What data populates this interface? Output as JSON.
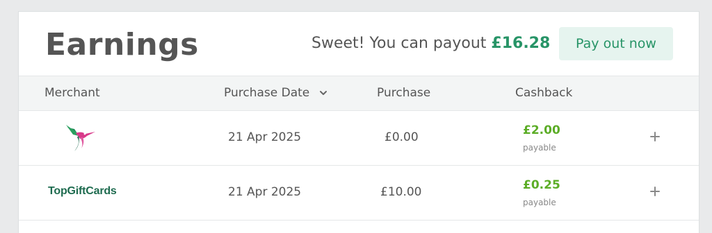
{
  "header": {
    "title": "Earnings",
    "payout_prefix": "Sweet! You can payout ",
    "payout_amount": "£16.28",
    "payout_button": "Pay out now"
  },
  "table": {
    "columns": [
      "Merchant",
      "Purchase Date",
      "Purchase",
      "Cashback"
    ],
    "sort_icon": "chevron-down-icon",
    "rows": [
      {
        "merchant_logo": "hummingbird-logo",
        "merchant_text": "",
        "date": "21 Apr 2025",
        "purchase": "£0.00",
        "cashback": "£2.00",
        "status": "payable",
        "expand_icon": "plus-icon"
      },
      {
        "merchant_logo": "topgiftcards-logo",
        "merchant_text": "TopGiftCards",
        "date": "21 Apr 2025",
        "purchase": "£10.00",
        "cashback": "£0.25",
        "status": "payable",
        "expand_icon": "plus-icon"
      }
    ]
  },
  "colors": {
    "accent_green": "#279467",
    "cashback_green": "#5cad27",
    "button_bg": "#e6f4ef",
    "header_bg": "#f3f5f5"
  }
}
